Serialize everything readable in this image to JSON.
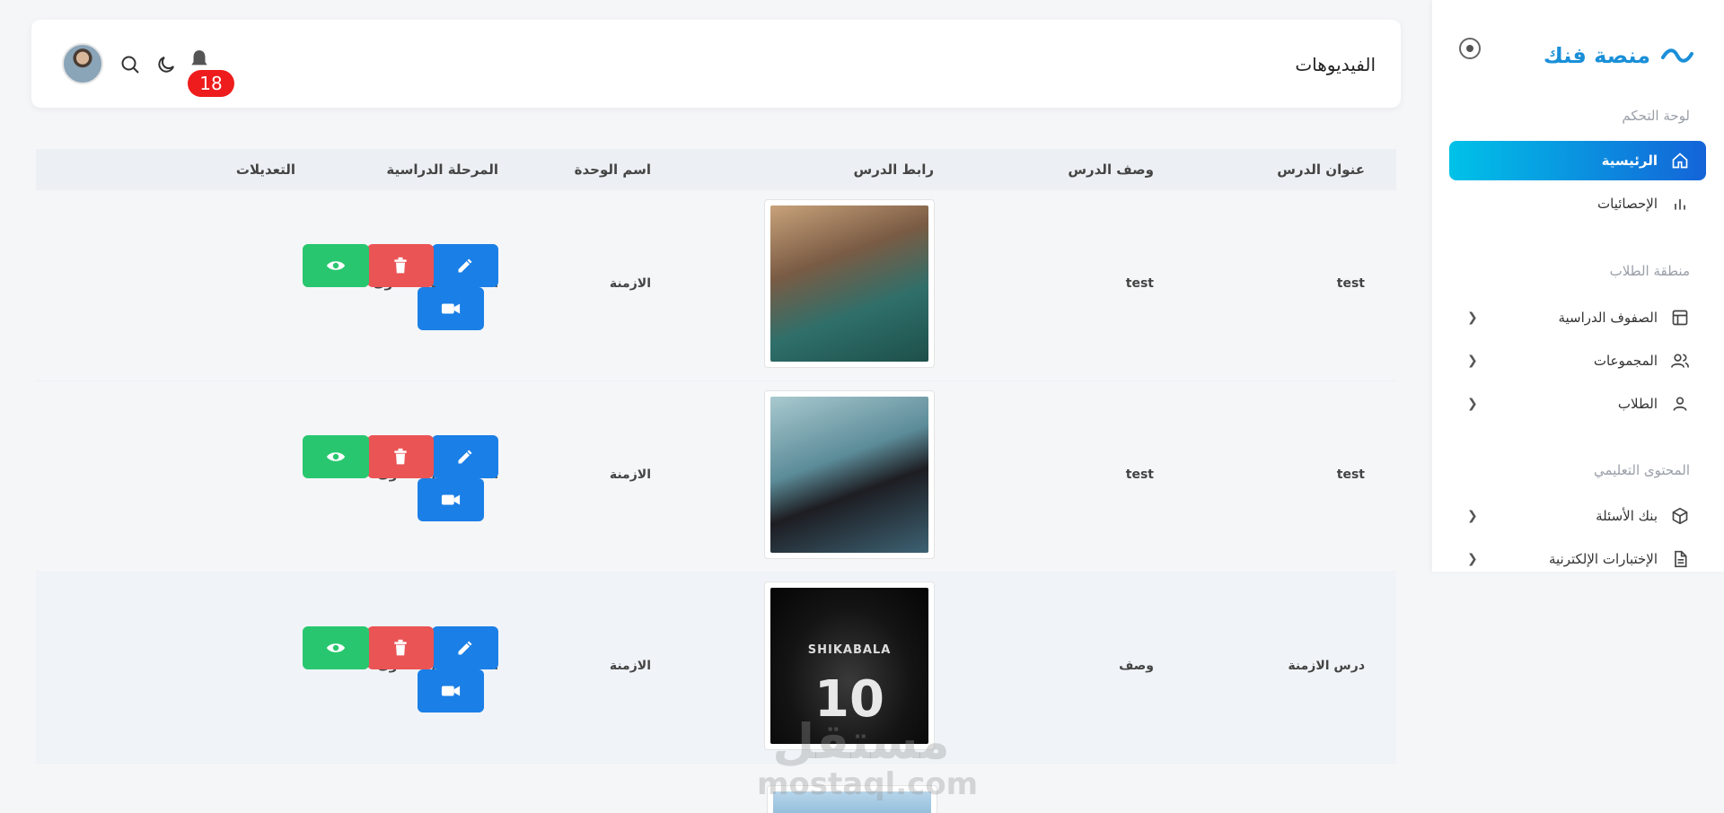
{
  "brand": {
    "name": "منصة فنك"
  },
  "sidebar": {
    "sections": [
      {
        "label": "لوحة التحكم",
        "items": [
          {
            "label": "الرئيسية",
            "icon": "home-icon",
            "active": true
          },
          {
            "label": "الإحصائيات",
            "icon": "stats-icon"
          }
        ]
      },
      {
        "label": "منطقة الطلاب",
        "items": [
          {
            "label": "الصفوف الدراسية",
            "icon": "layout-icon"
          },
          {
            "label": "المجموعات",
            "icon": "users-icon"
          },
          {
            "label": "الطلاب",
            "icon": "user-icon"
          }
        ]
      },
      {
        "label": "المحتوى التعليمي",
        "items": [
          {
            "label": "بنك الأسئلة",
            "icon": "cube-icon"
          },
          {
            "label": "الإختبارات الإلكترنية",
            "icon": "document-icon"
          }
        ]
      }
    ]
  },
  "header": {
    "title": "الفيديوهات",
    "notifications_count": "18"
  },
  "table": {
    "columns": [
      "عنوان الدرس",
      "وصف الدرس",
      "رابط الدرس",
      "اسم الوحدة",
      "المرحلة الدراسية",
      "التعديلات"
    ],
    "rows": [
      {
        "title": "test",
        "description": "test",
        "unit": "الازمنة",
        "stage": "الصف الثالث الثانوى"
      },
      {
        "title": "test",
        "description": "test",
        "unit": "الازمنة",
        "stage": "الصف الاول الثانوى"
      },
      {
        "title": "درس الازمنة",
        "description": "وصف",
        "unit": "الازمنة",
        "stage": "الصف الاول الثانوى",
        "thumb_name": "SHIKABALA",
        "thumb_number": "10"
      }
    ]
  },
  "watermark": {
    "arabic": "مستقل",
    "latin": "mostaql.com"
  },
  "colors": {
    "accent": "#1a7fe6",
    "danger": "#ea5455",
    "success": "#28c76f",
    "badge": "#ee1c1c"
  }
}
